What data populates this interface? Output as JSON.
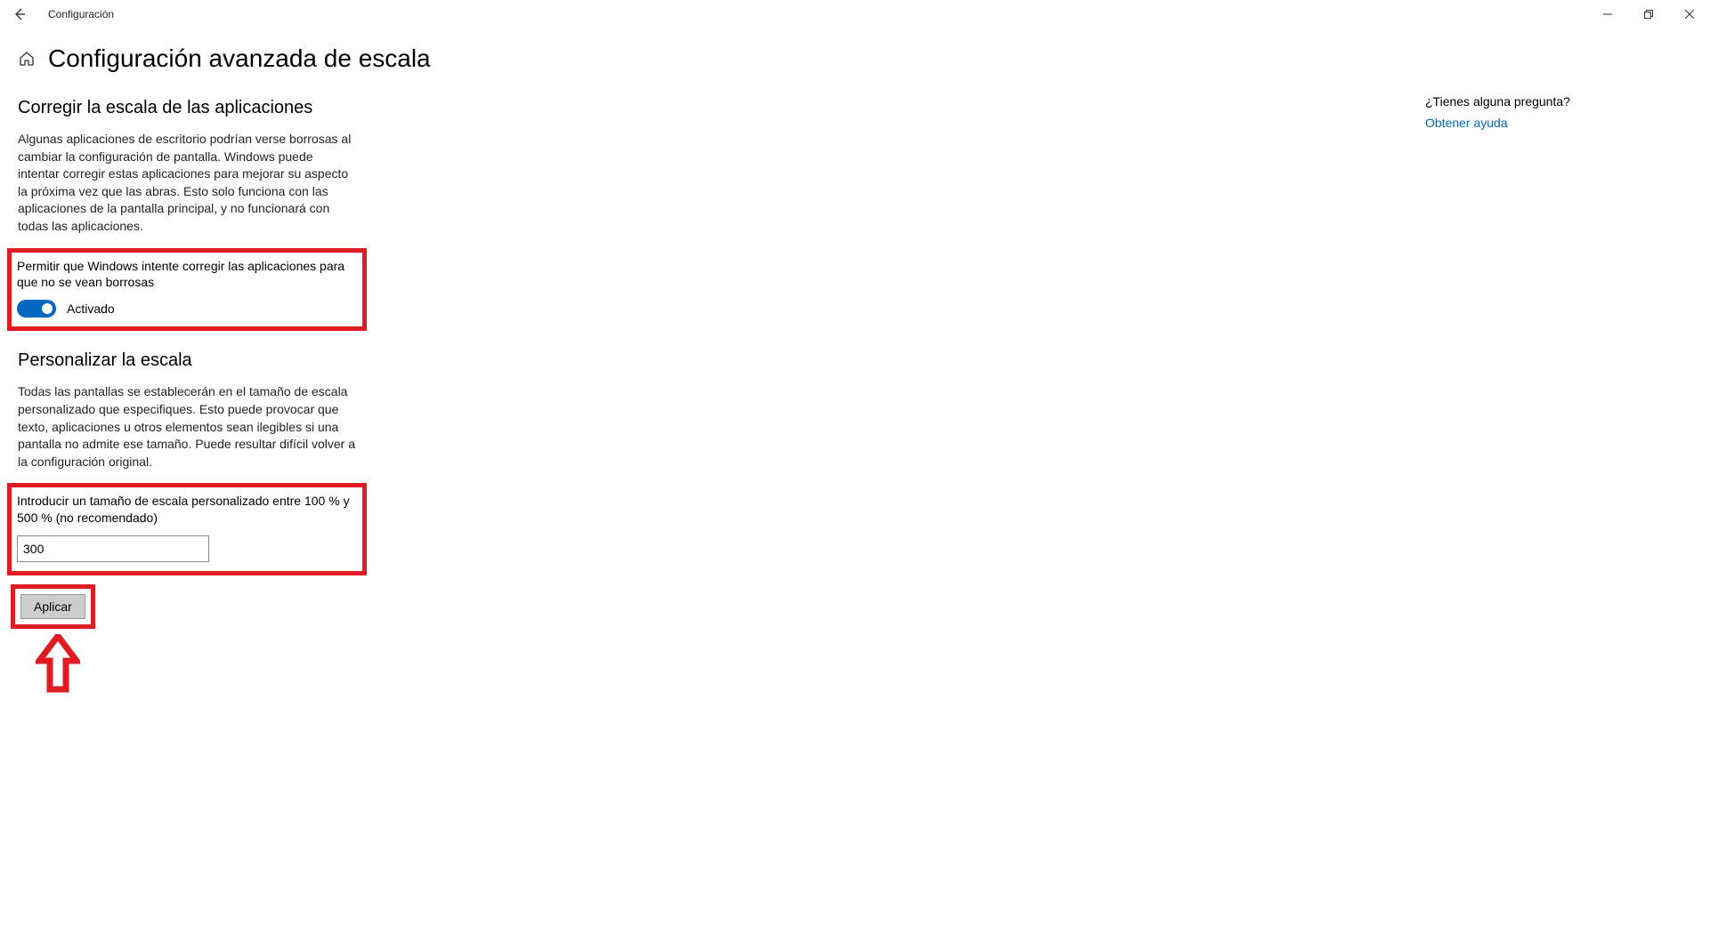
{
  "titlebar": {
    "back_aria": "Atrás",
    "app_title": "Configuración"
  },
  "page": {
    "title": "Configuración avanzada de escala"
  },
  "section1": {
    "heading": "Corregir la escala de las aplicaciones",
    "body": "Algunas aplicaciones de escritorio podrían verse borrosas al cambiar la configuración de pantalla. Windows puede intentar corregir estas aplicaciones para mejorar su aspecto la próxima vez que las abras. Esto solo funciona con las aplicaciones de la pantalla principal, y no funcionará con todas las aplicaciones.",
    "toggle_label": "Permitir que Windows intente corregir las aplicaciones para que no se vean borrosas",
    "toggle_status": "Activado"
  },
  "section2": {
    "heading": "Personalizar la escala",
    "body": "Todas las pantallas se establecerán en el tamaño de escala personalizado que especifiques. Esto puede provocar que texto, aplicaciones u otros elementos sean ilegibles si una pantalla no admite ese tamaño. Puede resultar difícil volver a la configuración original.",
    "input_label": "Introducir un tamaño de escala personalizado entre 100 % y 500 % (no recomendado)",
    "input_value": "300"
  },
  "actions": {
    "apply_label": "Aplicar"
  },
  "help": {
    "heading": "¿Tienes alguna pregunta?",
    "link": "Obtener ayuda"
  }
}
